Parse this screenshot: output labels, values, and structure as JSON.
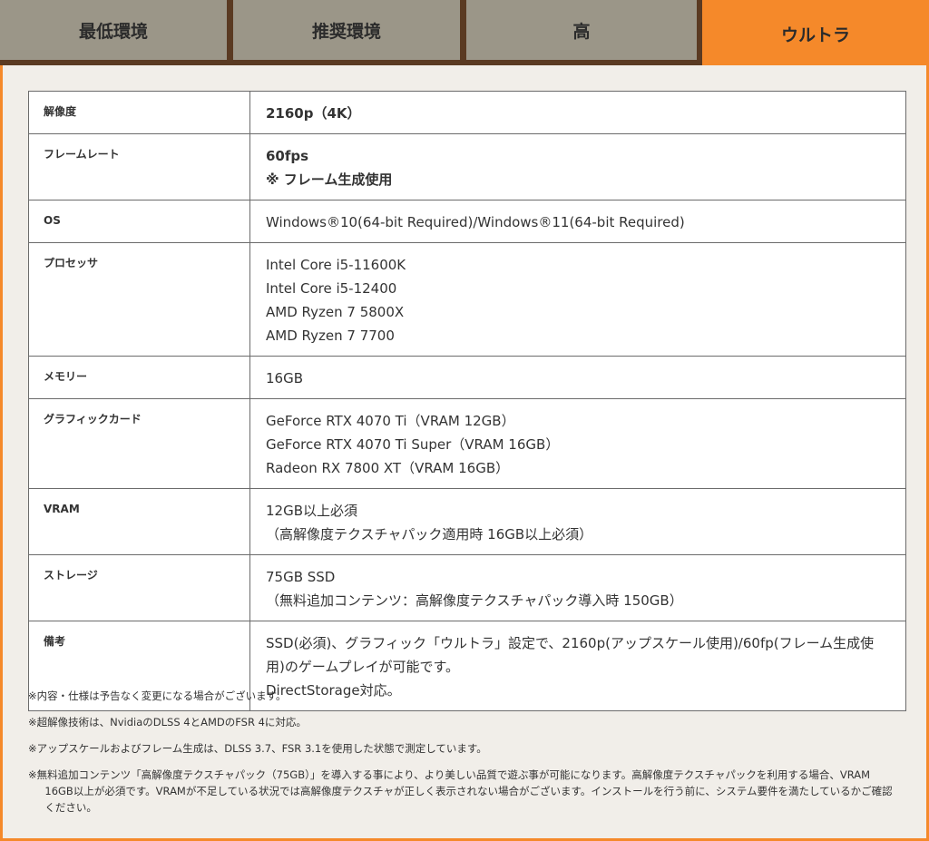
{
  "tabs": [
    {
      "label": "最低環境",
      "active": false
    },
    {
      "label": "推奨環境",
      "active": false
    },
    {
      "label": "高",
      "active": false
    },
    {
      "label": "ウルトラ",
      "active": true
    }
  ],
  "spec": {
    "resolution": {
      "label": "解像度",
      "value": "2160p（4K）"
    },
    "framerate": {
      "label": "フレームレート",
      "lines": [
        "60fps",
        "※ フレーム生成使用"
      ]
    },
    "os": {
      "label": "OS",
      "value": "Windows®10(64-bit Required)/Windows®11(64-bit Required)"
    },
    "processor": {
      "label": "プロセッサ",
      "lines": [
        "Intel Core i5-11600K",
        "Intel Core i5-12400",
        "AMD Ryzen 7 5800X",
        "AMD Ryzen 7 7700"
      ]
    },
    "memory": {
      "label": "メモリー",
      "value": "16GB"
    },
    "gpu": {
      "label": "グラフィックカード",
      "lines": [
        "GeForce RTX 4070 Ti（VRAM 12GB）",
        "GeForce RTX 4070 Ti Super（VRAM 16GB）",
        "Radeon RX 7800 XT（VRAM 16GB）"
      ]
    },
    "vram": {
      "label": "VRAM",
      "lines": [
        "12GB以上必須",
        "（高解像度テクスチャパック適用時 16GB以上必須）"
      ]
    },
    "storage": {
      "label": "ストレージ",
      "lines": [
        "75GB SSD",
        "（無料追加コンテンツ：高解像度テクスチャパック導入時 150GB）"
      ]
    },
    "notes_row": {
      "label": "備考",
      "text": "SSD(必須)、グラフィック「ウルトラ」設定で、2160p(アップスケール使用)/60fp(フレーム生成使用)のゲームプレイが可能です。",
      "extra": "DirectStorage対応。"
    }
  },
  "footnotes": [
    "※内容・仕様は予告なく変更になる場合がございます。",
    "※超解像技術は、NvidiaのDLSS 4とAMDのFSR 4に対応。",
    "※アップスケールおよびフレーム生成は、DLSS 3.7、FSR 3.1を使用した状態で測定しています。",
    "※無料追加コンテンツ「高解像度テクスチャパック（75GB）」を導入する事により、より美しい品質で遊ぶ事が可能になります。高解像度テクスチャパックを利用する場合、VRAM 16GB以上が必須です。VRAMが不足している状況では高解像度テクスチャが正しく表示されない場合がございます。インストールを行う前に、システム要件を満たしているかご確認ください。"
  ]
}
